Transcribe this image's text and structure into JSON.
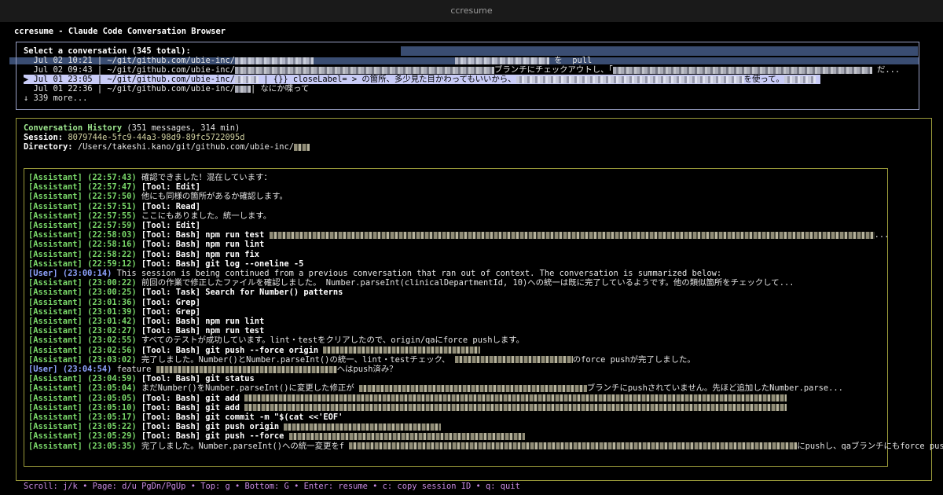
{
  "window": {
    "title": "ccresume"
  },
  "app": {
    "title": "ccresume - Claude Code Conversation Browser"
  },
  "selector": {
    "heading": "Select a conversation (345 total):",
    "conversations": [
      {
        "date": "Jul 02 10:21",
        "path": "~/git/github.com/ubie-inc/",
        "summary": "を  pull",
        "selected": false
      },
      {
        "date": "Jul 02 09:43",
        "path": "~/git/github.com/ubie-inc/",
        "summary": "ブランチにチェックアウトし、「",
        "tail": "だ...",
        "selected": false
      },
      {
        "date": "Jul 01 23:05",
        "path": "~/git/github.com/ubie-inc/",
        "summary": "| {}} closeLabel= > の箇所、多少見た目かわってもいいから、",
        "tail": "を使って。",
        "selected": true
      },
      {
        "date": "Jul 01 22:36",
        "path": "~/git/github.com/ubie-inc/",
        "summary": "| なにか喋って",
        "selected": false
      }
    ],
    "more": "↓ 339 more..."
  },
  "history": {
    "label": "Conversation History",
    "stats": "(351 messages, 314 min)",
    "session_label": "Session:",
    "session_id": "8079744e-5fc9-44a3-98d9-89fc5722095d",
    "directory_label": "Directory:",
    "directory": "/Users/takeshi.kano/git/github.com/ubie-inc/"
  },
  "messages": [
    {
      "role": "[Assistant]",
      "time": "(22:57:43)",
      "text": "確認できました！混在しています：",
      "tool": false
    },
    {
      "role": "[Assistant]",
      "time": "(22:57:47)",
      "text": "[Tool: Edit]",
      "tool": true
    },
    {
      "role": "[Assistant]",
      "time": "(22:57:50)",
      "text": "他にも同様の箇所があるか確認します。",
      "tool": false
    },
    {
      "role": "[Assistant]",
      "time": "(22:57:51)",
      "text": "[Tool: Read]",
      "tool": true
    },
    {
      "role": "[Assistant]",
      "time": "(22:57:55)",
      "text": "ここにもありました。統一します。",
      "tool": false
    },
    {
      "role": "[Assistant]",
      "time": "(22:57:59)",
      "text": "[Tool: Edit]",
      "tool": true
    },
    {
      "role": "[Assistant]",
      "time": "(22:58:03)",
      "text": "[Tool: Bash] npm run test",
      "tool": true,
      "tail": "..."
    },
    {
      "role": "[Assistant]",
      "time": "(22:58:16)",
      "text": "[Tool: Bash] npm run lint",
      "tool": true
    },
    {
      "role": "[Assistant]",
      "time": "(22:58:22)",
      "text": "[Tool: Bash] npm run fix",
      "tool": true
    },
    {
      "role": "[Assistant]",
      "time": "(22:59:12)",
      "text": "[Tool: Bash] git log --oneline -5",
      "tool": true
    },
    {
      "role": "[User]",
      "time": "(23:00:14)",
      "text": "This session is being continued from a previous conversation that ran out of context. The conversation is summarized below:",
      "tool": false
    },
    {
      "role": "[Assistant]",
      "time": "(23:00:22)",
      "text": "前回の作業で修正したファイルを確認しました。 Number.parseInt(clinicalDepartmentId, 10)への統一は既に完了しているようです。他の類似箇所をチェックして...",
      "tool": false
    },
    {
      "role": "[Assistant]",
      "time": "(23:00:25)",
      "text": "[Tool: Task] Search for Number() patterns",
      "tool": true
    },
    {
      "role": "[Assistant]",
      "time": "(23:01:36)",
      "text": "[Tool: Grep]",
      "tool": true
    },
    {
      "role": "[Assistant]",
      "time": "(23:01:39)",
      "text": "[Tool: Grep]",
      "tool": true
    },
    {
      "role": "[Assistant]",
      "time": "(23:01:42)",
      "text": "[Tool: Bash] npm run lint",
      "tool": true
    },
    {
      "role": "[Assistant]",
      "time": "(23:02:27)",
      "text": "[Tool: Bash] npm run test",
      "tool": true
    },
    {
      "role": "[Assistant]",
      "time": "(23:02:55)",
      "text": "すべてのテストが成功しています。lint・testをクリアしたので、origin/qaにforce pushします。",
      "tool": false
    },
    {
      "role": "[Assistant]",
      "time": "(23:02:56)",
      "text": "[Tool: Bash] git push --force origin",
      "tool": true
    },
    {
      "role": "[Assistant]",
      "time": "(23:03:02)",
      "text": "完了しました。Number()とNumber.parseInt()の統一、lint・testチェック、",
      "tool": false,
      "tail": "のforce pushが完了しました。"
    },
    {
      "role": "[User]",
      "time": "(23:04:54)",
      "text": "feature",
      "tool": false,
      "tail": "へはpush済み？"
    },
    {
      "role": "[Assistant]",
      "time": "(23:04:59)",
      "text": "[Tool: Bash] git status",
      "tool": true
    },
    {
      "role": "[Assistant]",
      "time": "(23:05:04)",
      "text": "まだNumber()をNumber.parseInt()に変更した修正が",
      "tool": false,
      "tail": "ブランチにpushされていません。先ほど追加したNumber.parse..."
    },
    {
      "role": "[Assistant]",
      "time": "(23:05:05)",
      "text": "[Tool: Bash] git add",
      "tool": true
    },
    {
      "role": "[Assistant]",
      "time": "(23:05:10)",
      "text": "[Tool: Bash] git add",
      "tool": true
    },
    {
      "role": "[Assistant]",
      "time": "(23:05:17)",
      "text": "[Tool: Bash] git commit -m \"$(cat <<'EOF'",
      "tool": true
    },
    {
      "role": "[Assistant]",
      "time": "(23:05:22)",
      "text": "[Tool: Bash] git push origin",
      "tool": true
    },
    {
      "role": "[Assistant]",
      "time": "(23:05:29)",
      "text": "[Tool: Bash] git push --force",
      "tool": true
    },
    {
      "role": "[Assistant]",
      "time": "(23:05:35)",
      "text": "完了しました。Number.parseInt()への統一変更をf",
      "tool": false,
      "tail": "にpushし、qaブランチにもforce pushしました。"
    }
  ],
  "footer": {
    "help": "Scroll: j/k • Page: d/u PgDn/PgUp • Top: g • Bottom: G • Enter: resume • c: copy session ID • q: quit"
  },
  "colors": {
    "assistant": "#7ad96a",
    "user": "#8fa4ff",
    "selection": "#c9ccf7",
    "footer": "#c98be0",
    "border_history": "#9a9a3a",
    "border_selector": "#9aa1c6"
  }
}
